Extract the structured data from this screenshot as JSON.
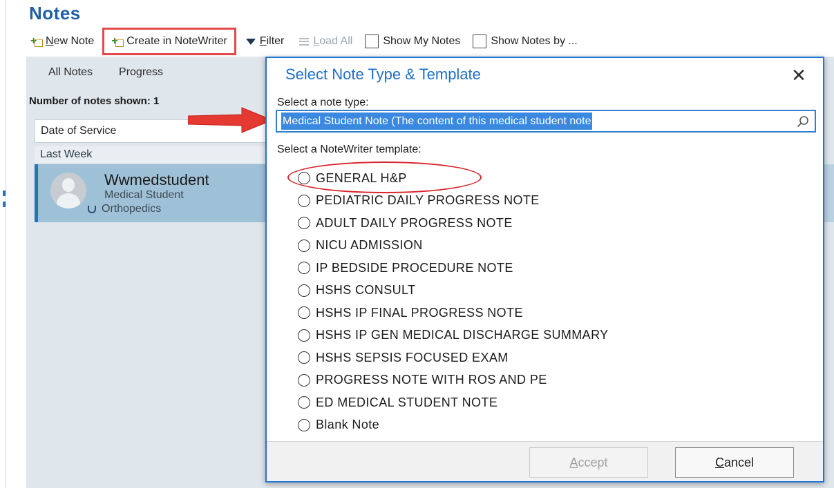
{
  "app": {
    "title": "Notes"
  },
  "toolbar": {
    "new_note": "New Note",
    "create_notewriter": "Create in NoteWriter",
    "filter": "Filter",
    "load_all": "Load All",
    "show_my_notes": "Show My Notes",
    "show_notes_by": "Show Notes by ..."
  },
  "notes_list": {
    "tabs": [
      "All Notes",
      "Progress"
    ],
    "count_text": "Number of notes shown: 1",
    "sort_by": "Date of Service",
    "group_header": "Last Week",
    "note": {
      "author": "Wwmedstudent",
      "role": "Medical Student",
      "department": "Orthopedics"
    }
  },
  "dialog": {
    "title": "Select Note Type & Template",
    "note_type_label": "Select a note type:",
    "note_type_value": "Medical Student Note (The content of this medical student note",
    "template_label": "Select a NoteWriter template:",
    "templates": [
      "GENERAL H&P",
      "PEDIATRIC DAILY PROGRESS NOTE",
      "ADULT DAILY PROGRESS NOTE",
      "NICU ADMISSION",
      "IP BEDSIDE PROCEDURE NOTE",
      "HSHS CONSULT",
      "HSHS IP FINAL PROGRESS NOTE",
      "HSHS IP GEN MEDICAL DISCHARGE SUMMARY",
      "HSHS SEPSIS FOCUSED EXAM",
      "PROGRESS NOTE WITH ROS AND PE",
      "ED MEDICAL STUDENT NOTE",
      "Blank Note"
    ],
    "accept_label": "Accept",
    "cancel_label": "Cancel"
  },
  "colors": {
    "accent_blue": "#1f6fc8",
    "selection_blue": "#3a88e0",
    "annotation_red": "#e54848",
    "panel_bg": "#dfe6ec",
    "selected_card": "#9fc1d8"
  }
}
